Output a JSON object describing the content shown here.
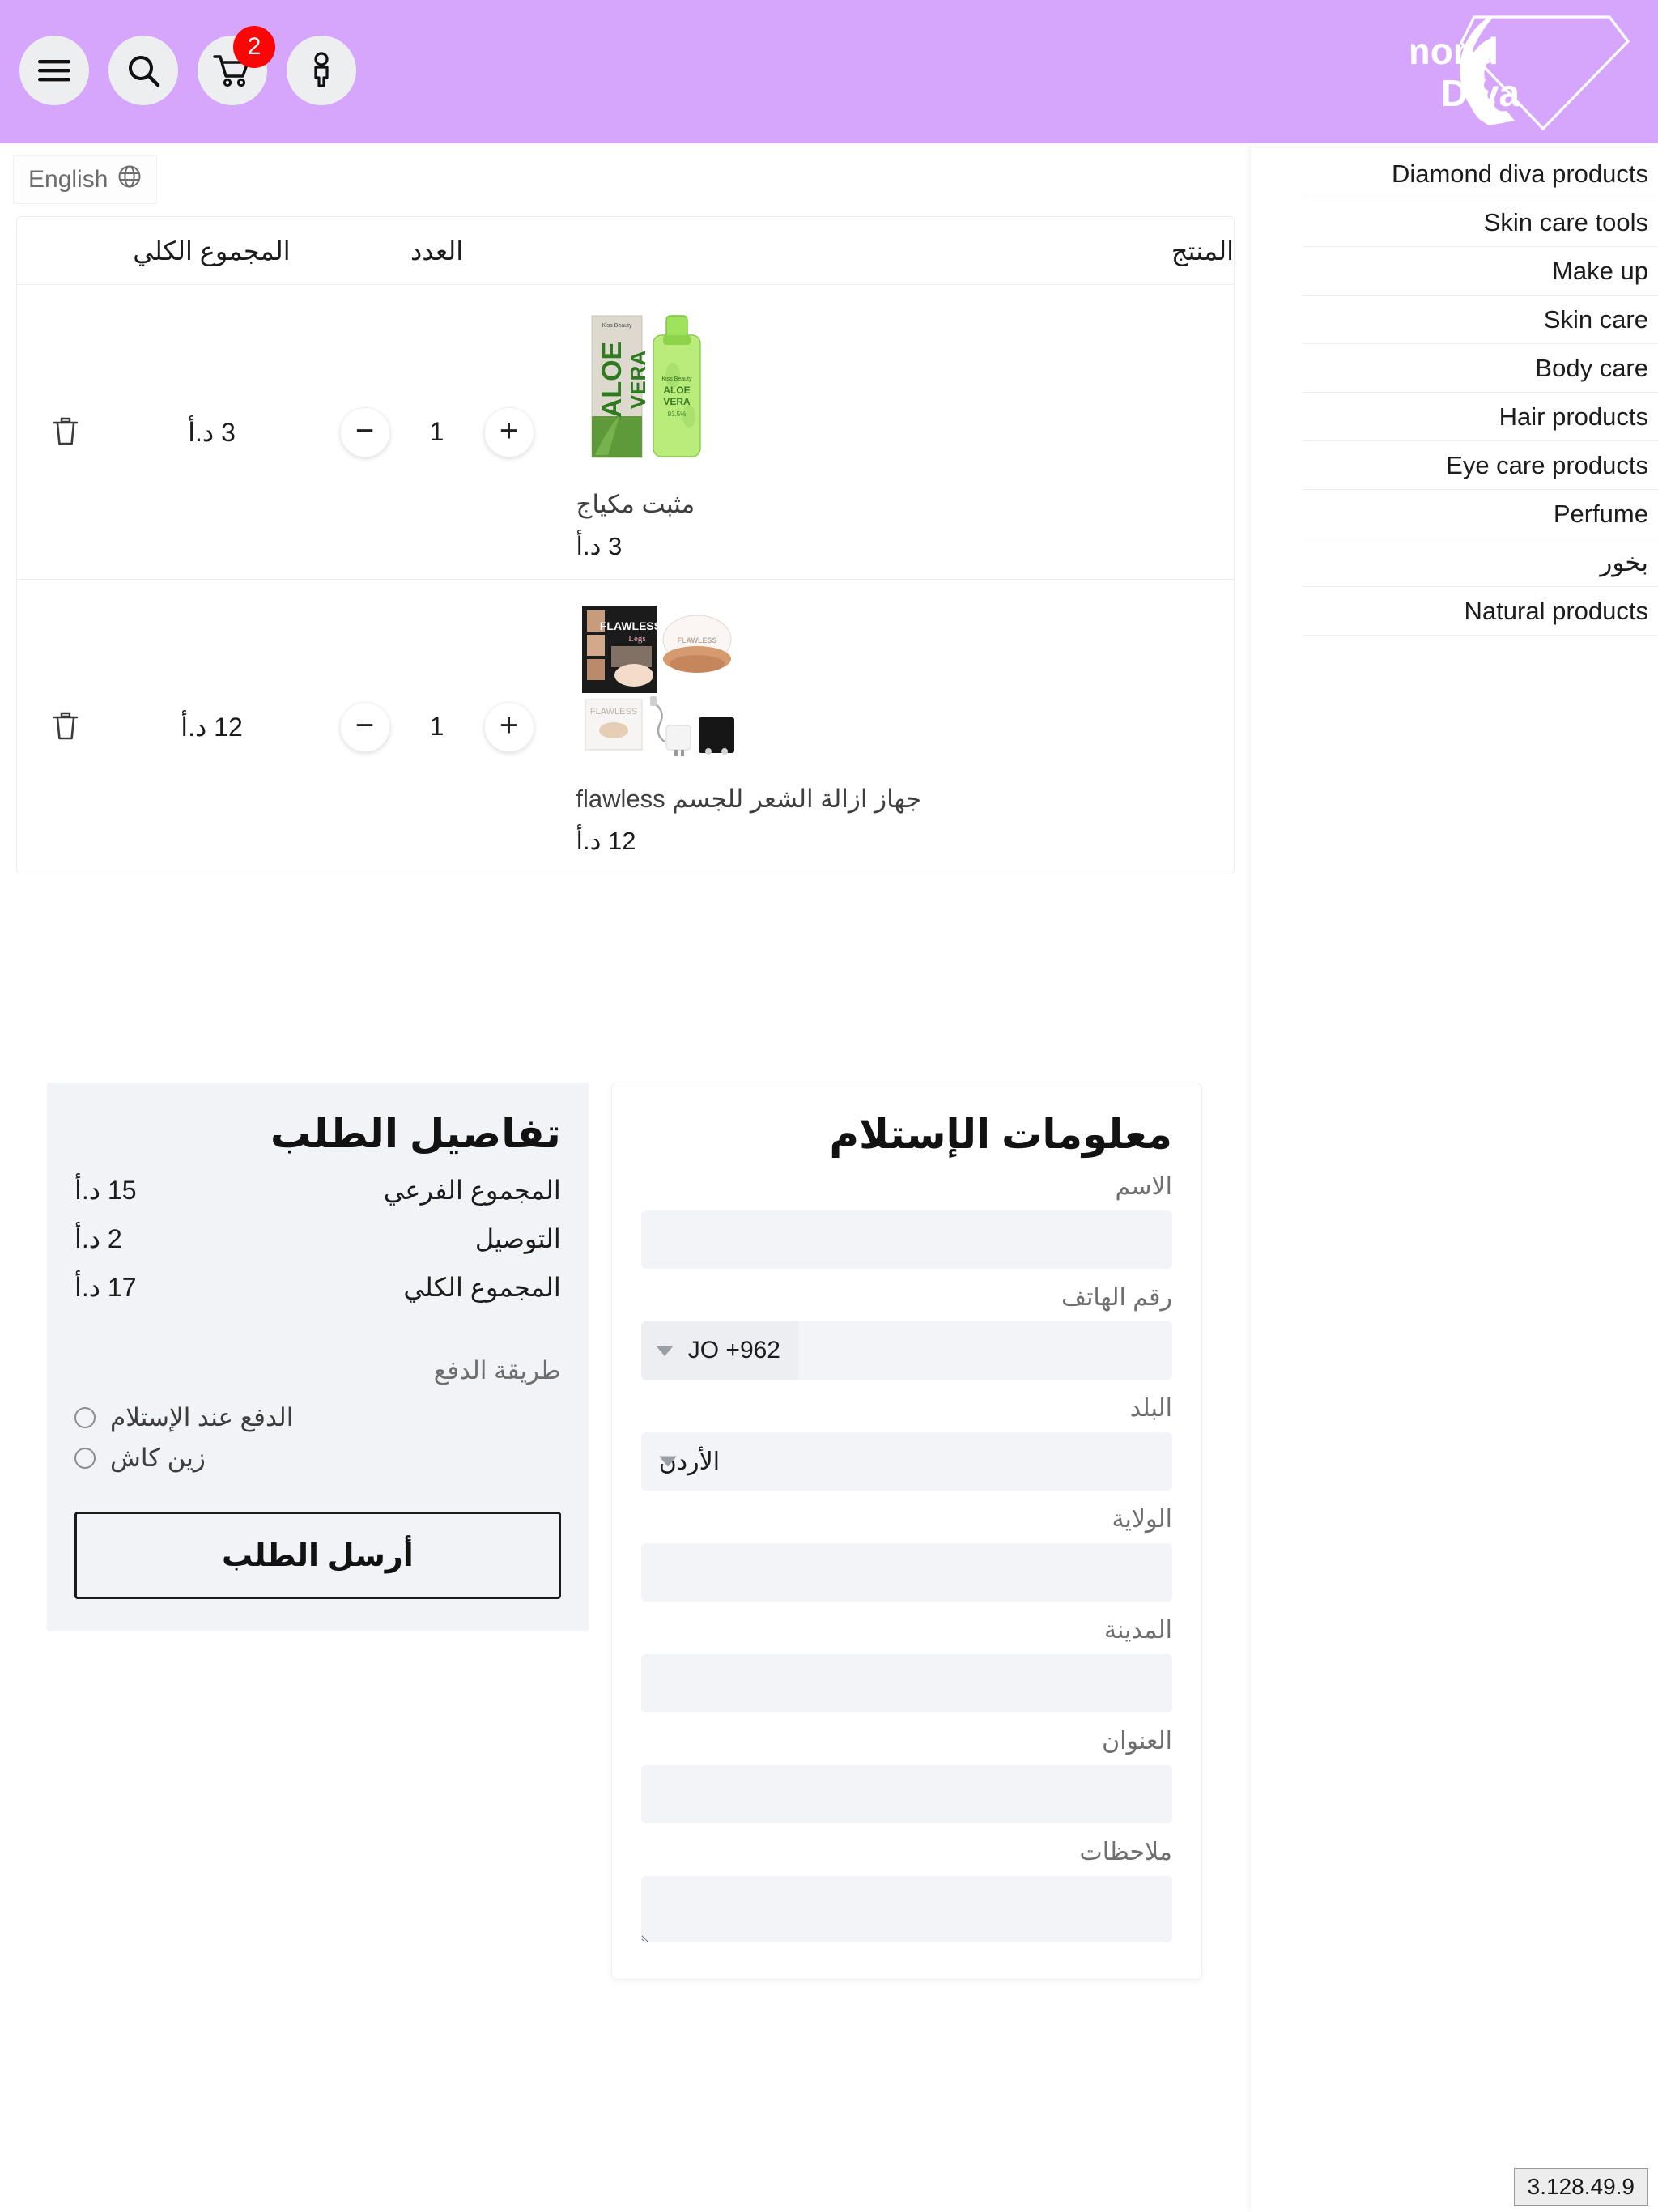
{
  "header": {
    "background_color": "#d5a6fc",
    "menu_label": "menu",
    "search_label": "search",
    "cart_label": "cart",
    "cart_badge": "2",
    "account_label": "account",
    "logo_line1": "Diamond",
    "logo_line2": "Diva"
  },
  "language_chip": {
    "label": "English",
    "icon": "globe-icon"
  },
  "sidebar": {
    "items": [
      {
        "label": "Diamond diva products"
      },
      {
        "label": "Skin care tools"
      },
      {
        "label": "Make up"
      },
      {
        "label": "Skin care"
      },
      {
        "label": "Body care"
      },
      {
        "label": "Hair products"
      },
      {
        "label": "Eye care products"
      },
      {
        "label": "Perfume"
      },
      {
        "label": "بخور"
      },
      {
        "label": "Natural products"
      }
    ]
  },
  "cart": {
    "columns": {
      "product": "المنتج",
      "quantity": "العدد",
      "total": "المجموع الكلي"
    },
    "rows": [
      {
        "name": "مثبت مكياج",
        "price": "3 د.أ",
        "quantity": "1",
        "line_total": "3 د.أ",
        "image_alt": "Kiss Beauty Aloe Vera Make Up Fix spray",
        "decrease": "−",
        "increase": "+",
        "delete": "trash-icon"
      },
      {
        "name": "جهاز ازالة الشعر للجسم flawless",
        "price": "12 د.أ",
        "quantity": "1",
        "line_total": "12 د.أ",
        "image_alt": "Flawless Legs hair removal device kit",
        "decrease": "−",
        "increase": "+",
        "delete": "trash-icon"
      }
    ]
  },
  "shipping": {
    "title": "معلومات الإستلام",
    "name_label": "الاسم",
    "name_value": "",
    "phone_label": "رقم الهاتف",
    "phone_country": "JO +962",
    "phone_value": "",
    "country_label": "البلد",
    "country_value": "الأردن",
    "state_label": "الولاية",
    "state_value": "",
    "city_label": "المدينة",
    "city_value": "",
    "address_label": "العنوان",
    "address_value": "",
    "notes_label": "ملاحظات",
    "notes_value": ""
  },
  "order": {
    "title": "تفاصيل الطلب",
    "subtotal_label": "المجموع الفرعي",
    "subtotal_value": "15 د.أ",
    "delivery_label": "التوصيل",
    "delivery_value": "2 د.أ",
    "total_label": "المجموع الكلي",
    "total_value": "17 د.أ",
    "payment_title": "طريقة الدفع",
    "payment_options": [
      {
        "label": "الدفع عند الإستلام"
      },
      {
        "label": "زين كاش"
      }
    ],
    "submit_label": "أرسل الطلب"
  },
  "footer": {
    "ip": "3.128.49.9"
  }
}
